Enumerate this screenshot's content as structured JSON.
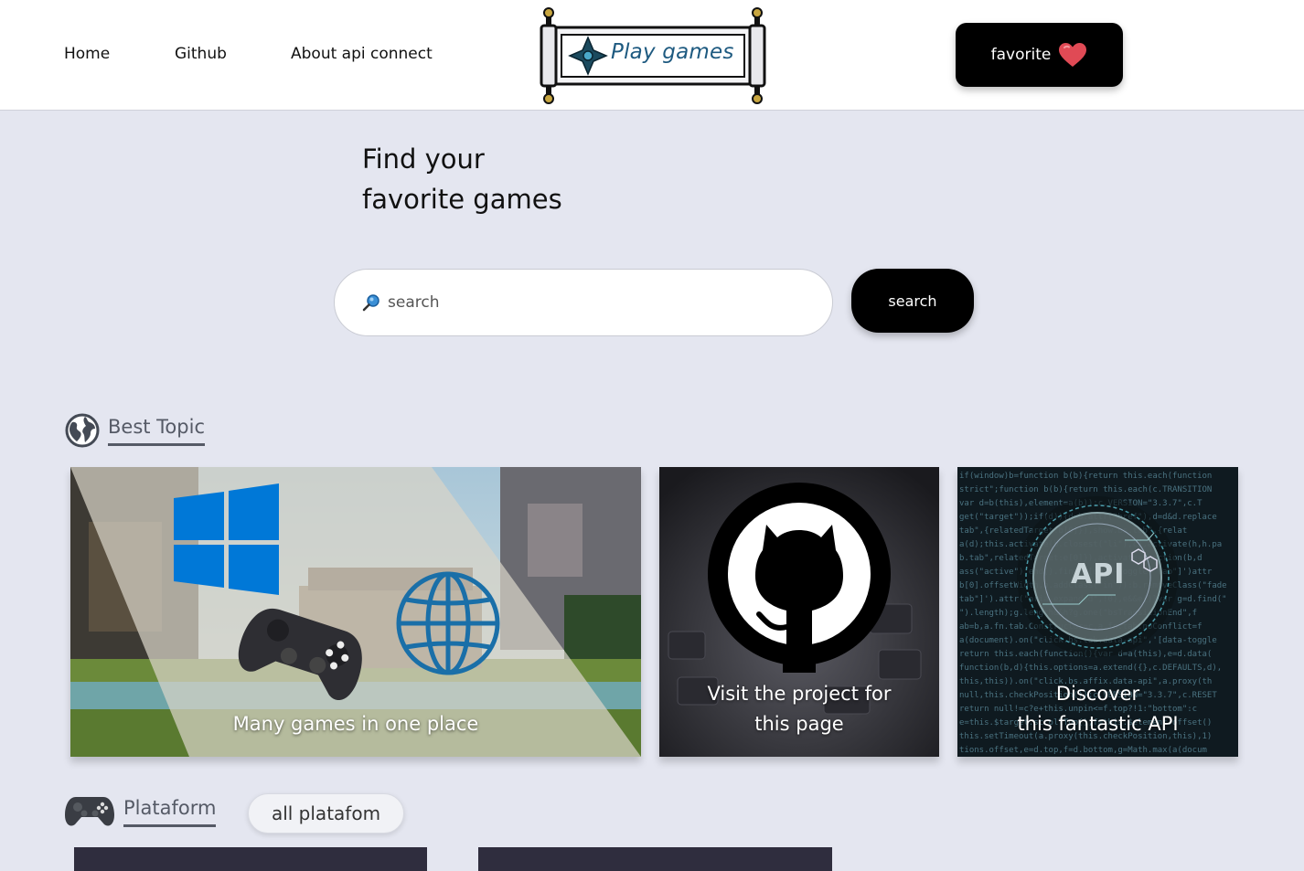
{
  "header": {
    "nav": [
      {
        "label": "Home"
      },
      {
        "label": "Github"
      },
      {
        "label": "About api connect"
      }
    ],
    "logo_text": "Play games",
    "favorite_label": "favorite"
  },
  "hero": {
    "title_line1": "Find your",
    "title_line2": "favorite games"
  },
  "search": {
    "placeholder": "search",
    "value": "",
    "button_label": "search"
  },
  "best_topic": {
    "title": "Best Topic",
    "icon": "globe-icon",
    "cards": [
      {
        "caption": "Many games in one place"
      },
      {
        "caption_line1": "Visit the project for",
        "caption_line2": "this page"
      },
      {
        "caption_line1": "Discover",
        "caption_line2": "this fantastic API",
        "badge": "API"
      }
    ]
  },
  "platform": {
    "title": "Plataform",
    "icon": "gamepad-icon",
    "all_button_label": "all platafom"
  },
  "colors": {
    "page_bg": "#e4e6f0",
    "header_bg": "#ffffff",
    "button_bg": "#000000",
    "accent_blue": "#0078d7",
    "logo_text": "#1e5a80",
    "heart": "#e04a55"
  }
}
